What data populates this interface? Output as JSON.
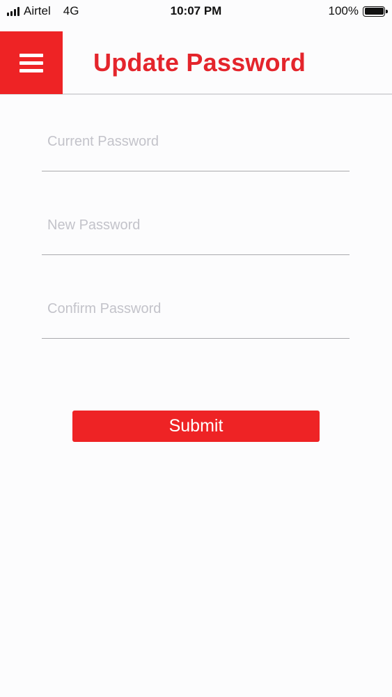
{
  "status_bar": {
    "carrier": "Airtel",
    "network": "4G",
    "time": "10:07 PM",
    "battery": "100%"
  },
  "header": {
    "title": "Update Password",
    "menu_icon": "hamburger-menu-icon"
  },
  "form": {
    "current_password": {
      "placeholder": "Current Password",
      "value": ""
    },
    "new_password": {
      "placeholder": "New Password",
      "value": ""
    },
    "confirm_password": {
      "placeholder": "Confirm Password",
      "value": ""
    },
    "submit_label": "Submit"
  },
  "colors": {
    "accent": "#ee2325",
    "title": "#e4252c",
    "divider": "#a9a9ad",
    "placeholder": "#c3c3ca"
  }
}
